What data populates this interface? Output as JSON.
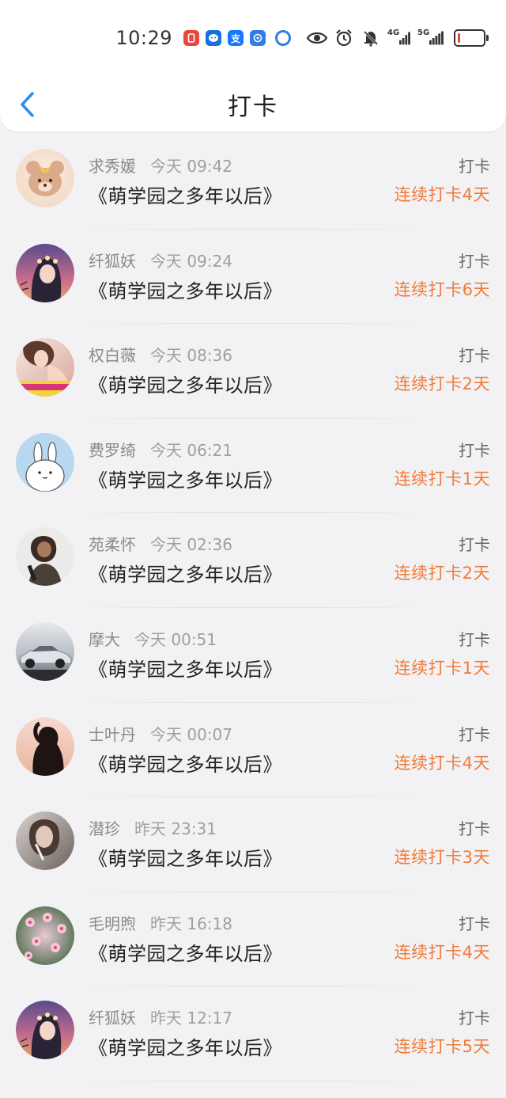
{
  "status_bar": {
    "time": "10:29",
    "network_1": "4G",
    "network_2": "5G",
    "battery_level": 0.08
  },
  "header": {
    "back_icon": "chevron-left-icon",
    "title": "打卡"
  },
  "colors": {
    "accent": "#2a8fe8",
    "streak": "#f07b3a"
  },
  "rows": [
    {
      "name": "求秀媛",
      "time": "今天 09:42",
      "book": "《萌学园之多年以后》",
      "action": "打卡",
      "streak": "连续打卡4天",
      "avatar": "teddy-bear-avatar"
    },
    {
      "name": "纤狐妖",
      "time": "今天 09:24",
      "book": "《萌学园之多年以后》",
      "action": "打卡",
      "streak": "连续打卡6天",
      "avatar": "anime-girl-avatar"
    },
    {
      "name": "权白薇",
      "time": "今天 08:36",
      "book": "《萌学园之多年以后》",
      "action": "打卡",
      "streak": "连续打卡2天",
      "avatar": "girl-photo-avatar"
    },
    {
      "name": "费罗绮",
      "time": "今天 06:21",
      "book": "《萌学园之多年以后》",
      "action": "打卡",
      "streak": "连续打卡1天",
      "avatar": "rabbit-avatar"
    },
    {
      "name": "苑柔怀",
      "time": "今天 02:36",
      "book": "《萌学园之多年以后》",
      "action": "打卡",
      "streak": "连续打卡2天",
      "avatar": "person-photo-avatar"
    },
    {
      "name": "摩大",
      "time": "今天 00:51",
      "book": "《萌学园之多年以后》",
      "action": "打卡",
      "streak": "连续打卡1天",
      "avatar": "car-avatar"
    },
    {
      "name": "士叶丹",
      "time": "今天 00:07",
      "book": "《萌学园之多年以后》",
      "action": "打卡",
      "streak": "连续打卡4天",
      "avatar": "silhouette-avatar"
    },
    {
      "name": "潜珍",
      "time": "昨天 23:31",
      "book": "《萌学园之多年以后》",
      "action": "打卡",
      "streak": "连续打卡3天",
      "avatar": "woman-photo-avatar"
    },
    {
      "name": "毛明煦",
      "time": "昨天 16:18",
      "book": "《萌学园之多年以后》",
      "action": "打卡",
      "streak": "连续打卡4天",
      "avatar": "flowers-avatar"
    },
    {
      "name": "纤狐妖",
      "time": "昨天 12:17",
      "book": "《萌学园之多年以后》",
      "action": "打卡",
      "streak": "连续打卡5天",
      "avatar": "anime-girl-avatar"
    }
  ]
}
